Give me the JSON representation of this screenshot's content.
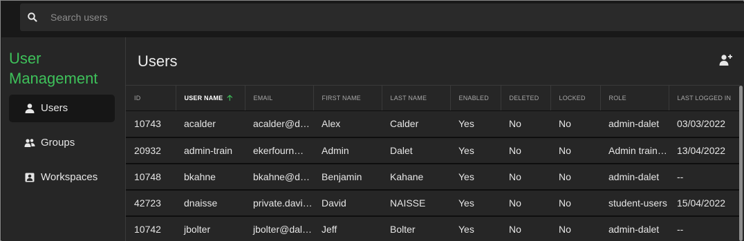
{
  "search": {
    "placeholder": "Search users"
  },
  "sidebar": {
    "title_line1": "User",
    "title_line2": "Management",
    "items": [
      {
        "label": "Users",
        "icon": "person-icon",
        "active": true
      },
      {
        "label": "Groups",
        "icon": "group-icon",
        "active": false
      },
      {
        "label": "Workspaces",
        "icon": "workspace-icon",
        "active": false
      }
    ]
  },
  "main": {
    "title": "Users",
    "add_button_icon": "add-user-icon"
  },
  "table": {
    "columns": [
      "ID",
      "USER NAME",
      "EMAIL",
      "FIRST NAME",
      "LAST NAME",
      "ENABLED",
      "DELETED",
      "LOCKED",
      "ROLE",
      "LAST LOGGED IN"
    ],
    "sorted_column": "USER NAME",
    "sort_direction": "ascending",
    "rows": [
      [
        "10743",
        "acalder",
        "acalder@dalet.com",
        "Alex",
        "Calder",
        "Yes",
        "No",
        "No",
        "admin-dalet",
        "03/03/2022"
      ],
      [
        "20932",
        "admin-train",
        "ekerfourn@dalet.com",
        "Admin",
        "Dalet",
        "Yes",
        "No",
        "No",
        "Admin training",
        "13/04/2022"
      ],
      [
        "10748",
        "bkahne",
        "bkahne@dalet.com",
        "Benjamin",
        "Kahane",
        "Yes",
        "No",
        "No",
        "admin-dalet",
        "--"
      ],
      [
        "42723",
        "dnaisse",
        "private.david.naisse",
        "David",
        "NAISSE",
        "Yes",
        "No",
        "No",
        "student-users",
        "15/04/2022"
      ],
      [
        "10742",
        "jbolter",
        "jbolter@dalet.com",
        "Jeff",
        "Bolter",
        "Yes",
        "No",
        "No",
        "admin-dalet",
        "--"
      ]
    ]
  },
  "colors": {
    "accent": "#3ec15a",
    "background": "#262626",
    "searchbar": "#2a2a2a"
  }
}
